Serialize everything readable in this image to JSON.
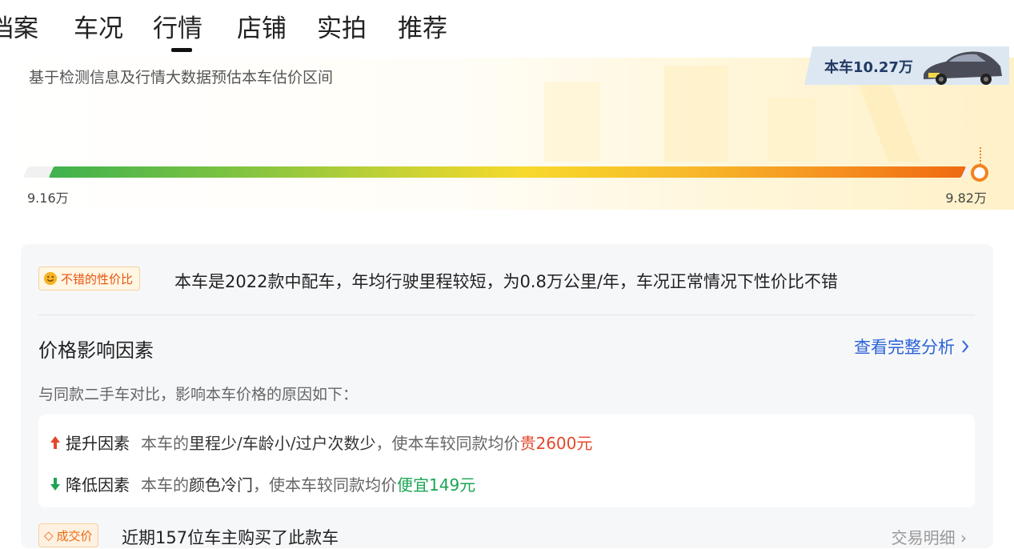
{
  "tabs": [
    {
      "label": "档案",
      "active": false
    },
    {
      "label": "车况",
      "active": false
    },
    {
      "label": "行情",
      "active": true
    },
    {
      "label": "店铺",
      "active": false
    },
    {
      "label": "实拍",
      "active": false
    },
    {
      "label": "推荐",
      "active": false
    }
  ],
  "estimate": {
    "subtitle": "基于检测信息及行情大数据预估本车估价区间",
    "car_price_label": "本车10.27万",
    "range_min": "9.16万",
    "range_max": "9.82万"
  },
  "summary": {
    "badge": "不错的性价比",
    "text": "本车是2022款中配车，年均行驶里程较短，为0.8万公里/年，车况正常情况下性价比不错"
  },
  "factors": {
    "title": "价格影响因素",
    "full_link": "查看完整分析",
    "desc": "与同款二手车对比，影响本车价格的原因如下：",
    "up": {
      "label": "提升因素",
      "prefix": "本车的",
      "key": "里程少/车龄小/过户次数少",
      "middle": "，使本车较同款均价",
      "value": "贵2600元"
    },
    "down": {
      "label": "降低因素",
      "prefix": "本车的",
      "key": "颜色冷门",
      "middle": "，使本车较同款均价",
      "value": "便宜149元"
    }
  },
  "deal": {
    "badge": "成交价",
    "text": "近期157位车主购买了此款车",
    "link": "交易明细"
  },
  "colors": {
    "accent_blue": "#2a63d8",
    "up_red": "#e5472b",
    "down_green": "#1aa552",
    "badge_orange": "#e8530e"
  }
}
